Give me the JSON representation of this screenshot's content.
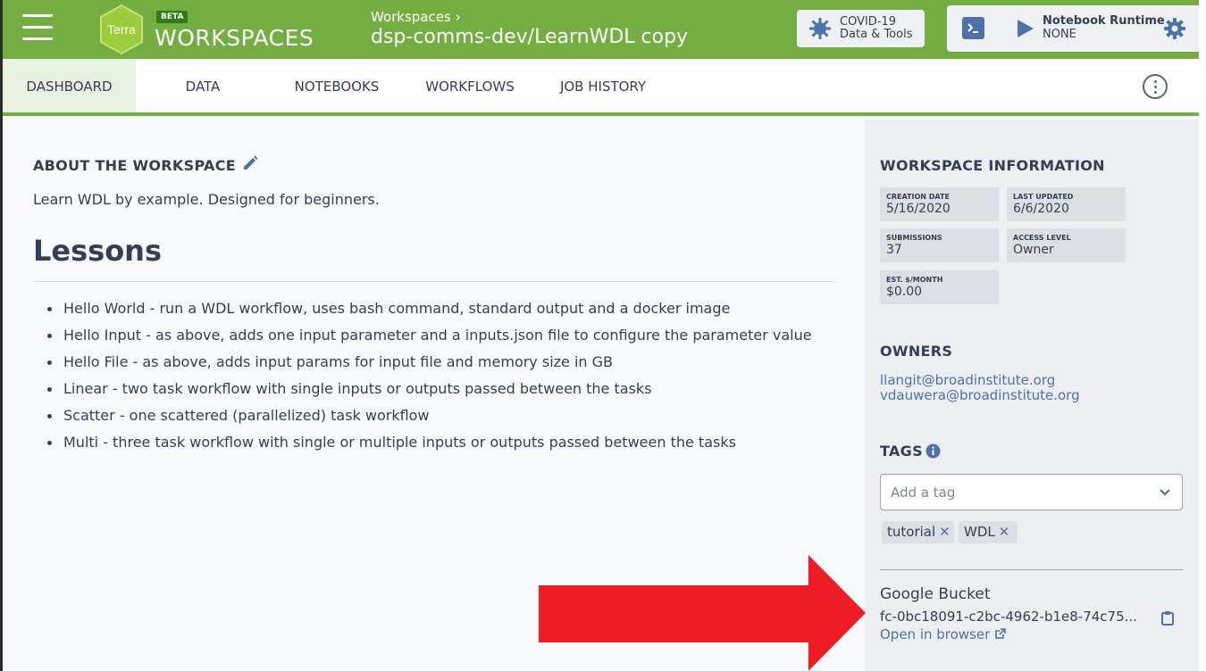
{
  "header": {
    "logo_text": "Terra",
    "beta_badge": "BETA",
    "brand": "WORKSPACES",
    "breadcrumb": "Workspaces ›",
    "workspace_name": "dsp-comms-dev/LearnWDL copy",
    "covid_line1": "COVID-19",
    "covid_line2": "Data & Tools",
    "runtime_title": "Notebook Runtime",
    "runtime_status": "NONE"
  },
  "tabs": [
    {
      "label": "DASHBOARD",
      "active": true
    },
    {
      "label": "DATA",
      "active": false
    },
    {
      "label": "NOTEBOOKS",
      "active": false
    },
    {
      "label": "WORKFLOWS",
      "active": false
    },
    {
      "label": "JOB HISTORY",
      "active": false
    }
  ],
  "main": {
    "about_heading": "ABOUT THE WORKSPACE",
    "description": "Learn WDL by example. Designed for beginners.",
    "lessons_heading": "Lessons",
    "lessons": [
      "Hello World - run a WDL workflow, uses bash command, standard output and a docker image",
      "Hello Input - as above, adds one input parameter and a inputs.json file to configure the parameter value",
      "Hello File - as above, adds input params for input file and memory size in GB",
      "Linear - two task workflow with single inputs or outputs passed between the tasks",
      "Scatter - one scattered (parallelized) task workflow",
      "Multi - three task workflow with single or multiple inputs or outputs passed between the tasks"
    ]
  },
  "side": {
    "info_heading": "WORKSPACE INFORMATION",
    "creation_label": "CREATION DATE",
    "creation_value": "5/16/2020",
    "updated_label": "LAST UPDATED",
    "updated_value": "6/6/2020",
    "submissions_label": "SUBMISSIONS",
    "submissions_value": "37",
    "access_label": "ACCESS LEVEL",
    "access_value": "Owner",
    "cost_label": "EST. $/MONTH",
    "cost_value": "$0.00",
    "owners_heading": "OWNERS",
    "owners": [
      "llangit@broadinstitute.org",
      "vdauwera@broadinstitute.org"
    ],
    "tags_heading": "TAGS",
    "tag_placeholder": "Add a tag",
    "tags": [
      "tutorial",
      "WDL"
    ],
    "bucket_heading": "Google Bucket",
    "bucket_name": "fc-0bc18091-c2bc-4962-b1e8-74c75...",
    "open_browser": "Open in browser"
  },
  "colors": {
    "brand_green": "#74ae43",
    "link_blue": "#4d72aa",
    "annotation_arrow": "#ee1c25"
  }
}
